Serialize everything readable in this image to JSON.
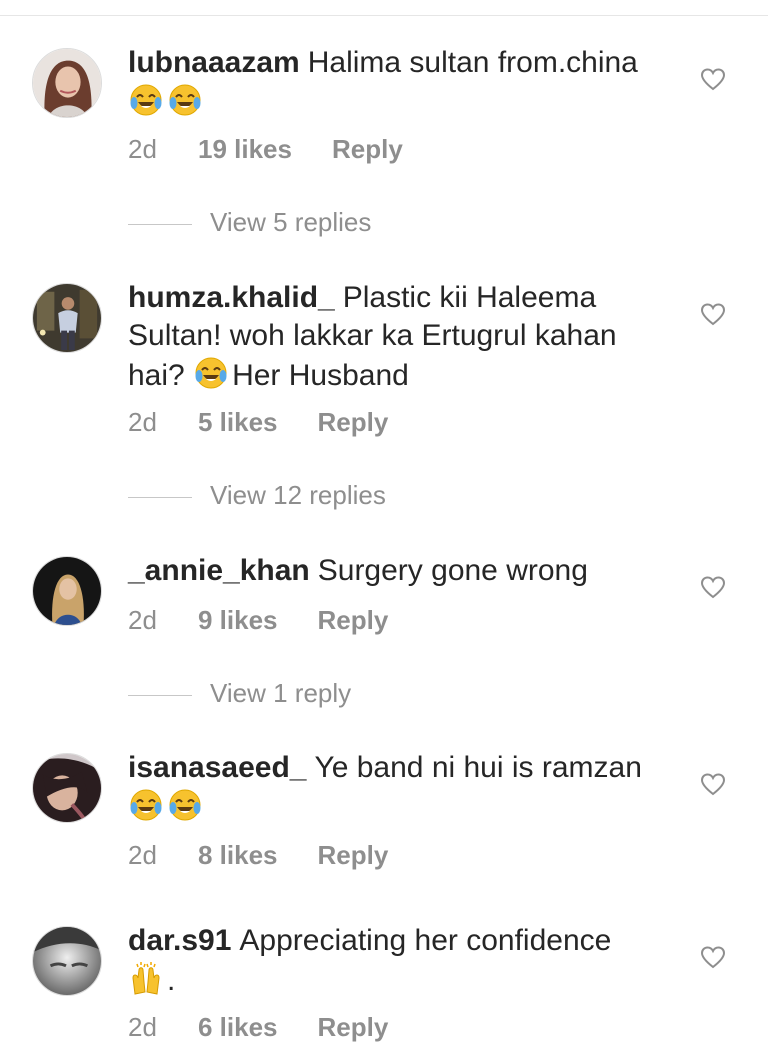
{
  "comments": [
    {
      "username": "lubnaaazam",
      "text": "Halima sultan from.china",
      "emoji_line": [
        "face-with-tears-of-joy-icon",
        "face-with-tears-of-joy-icon"
      ],
      "time": "2d",
      "likes": "19 likes",
      "reply": "Reply",
      "view_replies": "View 5 replies"
    },
    {
      "username": "humza.khalid_",
      "text_before": "Plastic kii Haleema Sultan! woh lakkar ka Ertugrul kahan hai?",
      "emoji_inline": "face-with-tears-of-joy-icon",
      "text_after": "Her Husband",
      "time": "2d",
      "likes": "5 likes",
      "reply": "Reply",
      "view_replies": "View 12 replies"
    },
    {
      "username": "_annie_khan",
      "text": "Surgery gone wrong",
      "time": "2d",
      "likes": "9 likes",
      "reply": "Reply",
      "view_replies": "View 1 reply"
    },
    {
      "username": "isanasaeed_",
      "text": "Ye band ni hui is ramzan",
      "emoji_line": [
        "face-with-tears-of-joy-icon",
        "face-with-tears-of-joy-icon"
      ],
      "time": "2d",
      "likes": "8 likes",
      "reply": "Reply"
    },
    {
      "username": "dar.s91",
      "text": "Appreciating her confidence",
      "emoji_line": [
        "raising-hands-icon"
      ],
      "text_trailing": ".",
      "time": "2d",
      "likes": "6 likes",
      "reply": "Reply"
    }
  ],
  "colors": {
    "text": "#262626",
    "meta": "#8e8e8e",
    "divider": "#c7c7c7",
    "emoji_yellow": "#f7c22e",
    "emoji_tear": "#57a9e8"
  }
}
